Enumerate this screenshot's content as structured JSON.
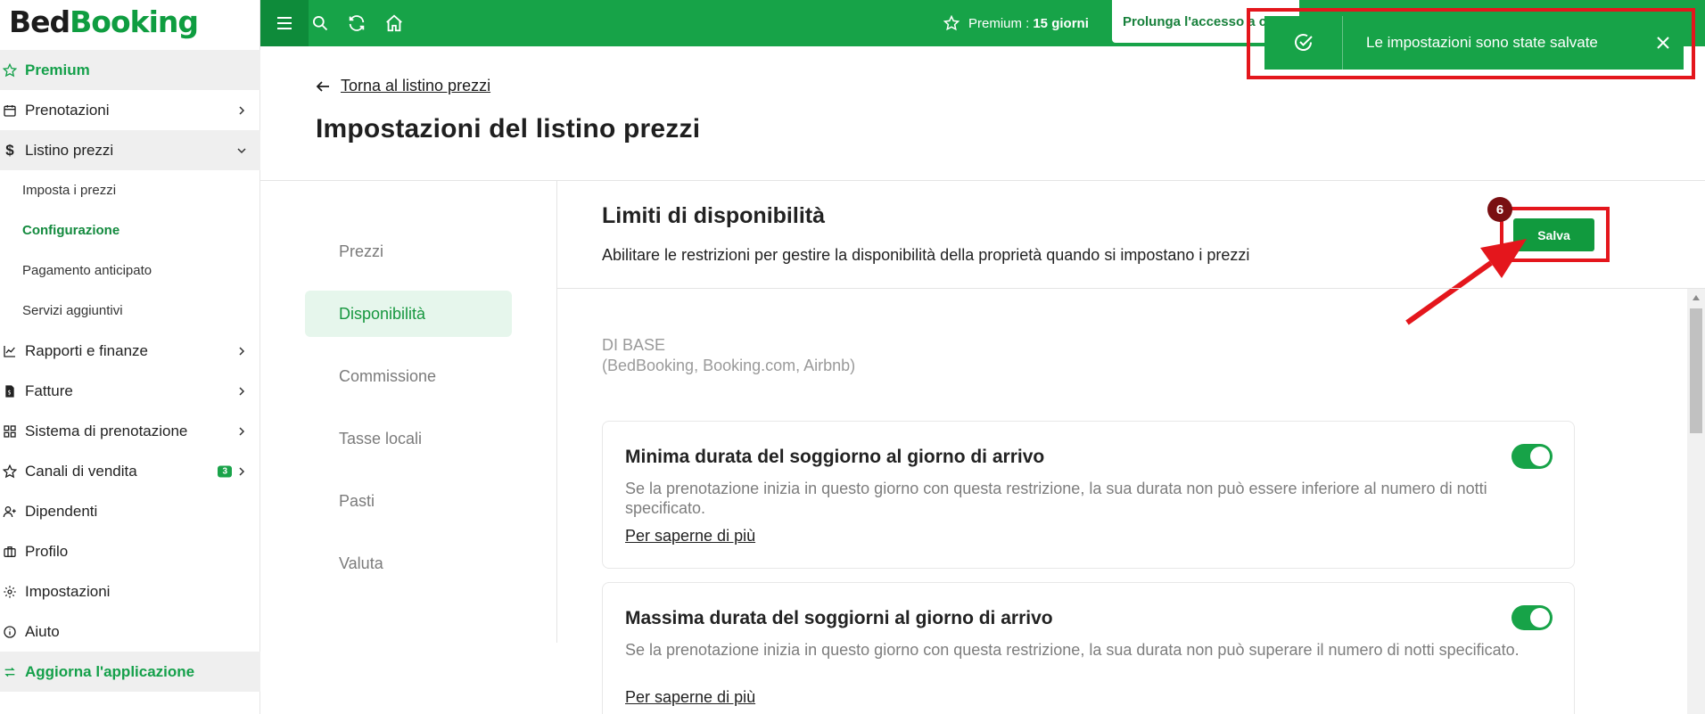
{
  "app": {
    "logo_part1": "Bed",
    "logo_part2": "Booking"
  },
  "sidebar": {
    "items": [
      {
        "label": "Premium",
        "icon": "star-icon"
      },
      {
        "label": "Prenotazioni",
        "icon": "calendar-icon"
      },
      {
        "label": "Listino prezzi",
        "icon": "dollar-icon"
      },
      {
        "label": "Imposta i prezzi"
      },
      {
        "label": "Configurazione"
      },
      {
        "label": "Pagamento anticipato"
      },
      {
        "label": "Servizi aggiuntivi"
      },
      {
        "label": "Rapporti e finanze",
        "icon": "chart-icon"
      },
      {
        "label": "Fatture",
        "icon": "invoice-icon"
      },
      {
        "label": "Sistema di prenotazione",
        "icon": "grid-icon"
      },
      {
        "label": "Canali di vendita",
        "icon": "star-icon",
        "badge": "3"
      },
      {
        "label": "Dipendenti",
        "icon": "user-plus-icon"
      },
      {
        "label": "Profilo",
        "icon": "briefcase-icon"
      },
      {
        "label": "Impostazioni",
        "icon": "gear-icon"
      },
      {
        "label": "Aiuto",
        "icon": "info-icon"
      },
      {
        "label": "Aggiorna l'applicazione",
        "icon": "refresh-icon"
      }
    ]
  },
  "topbar": {
    "premium_label": "Premium :",
    "premium_days": "15 giorni",
    "extend_label": "Prolunga l'accesso a co"
  },
  "toast": {
    "message": "Le impostazioni sono state salvate"
  },
  "page": {
    "back_label": "Torna al listino prezzi",
    "title": "Impostazioni del listino prezzi"
  },
  "tabs": [
    "Prezzi",
    "Disponibilità",
    "Commissione",
    "Tasse locali",
    "Pasti",
    "Valuta"
  ],
  "section": {
    "title": "Limiti di disponibilità",
    "description": "Abilitare le restrizioni per gestire la disponibilità della proprietà quando si impostano i prezzi",
    "save_label": "Salva",
    "step_number": "6",
    "group_label": "DI BASE",
    "group_sub": "(BedBooking, Booking.com, Airbnb)"
  },
  "cards": [
    {
      "title": "Minima durata del soggiorno al giorno di arrivo",
      "description": "Se la prenotazione inizia in questo giorno con questa restrizione, la sua durata non può essere inferiore al numero di notti specificato.",
      "link": "Per saperne di più",
      "enabled": true
    },
    {
      "title": "Massima durata del soggiorni al giorno di arrivo",
      "description": "Se la prenotazione inizia in questo giorno con questa restrizione, la sua durata non può superare il numero di notti specificato.",
      "link": "Per saperne di più",
      "enabled": true
    }
  ],
  "colors": {
    "brand_green": "#17a348",
    "highlight_red": "#e4161c",
    "badge_dark_red": "#7a0f12"
  }
}
